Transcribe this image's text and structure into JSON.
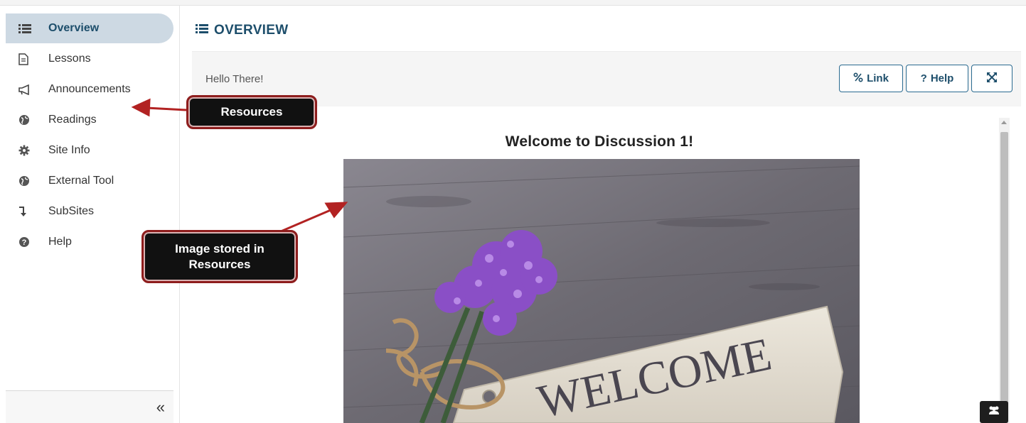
{
  "sidebar": {
    "items": [
      {
        "label": "Overview",
        "icon": "list-icon",
        "active": true
      },
      {
        "label": "Lessons",
        "icon": "document-icon",
        "active": false
      },
      {
        "label": "Announcements",
        "icon": "bullhorn-icon",
        "active": false
      },
      {
        "label": "Readings",
        "icon": "globe-icon",
        "active": false
      },
      {
        "label": "Site Info",
        "icon": "gear-icon",
        "active": false
      },
      {
        "label": "External Tool",
        "icon": "globe-icon",
        "active": false
      },
      {
        "label": "SubSites",
        "icon": "level-down-icon",
        "active": false
      },
      {
        "label": "Help",
        "icon": "question-circle-icon",
        "active": false
      }
    ],
    "collapse_label": "«"
  },
  "header": {
    "title": "OVERVIEW",
    "icon": "list-icon"
  },
  "toolbar": {
    "title": "Hello There!",
    "link_label": "Link",
    "help_label": "Help",
    "maximize_icon": "expand-icon"
  },
  "content": {
    "heading": "Welcome to Discussion 1!",
    "image_sign_text": "WELCOME"
  },
  "callouts": {
    "resources": "Resources",
    "image_line1": "Image stored in",
    "image_line2": "Resources"
  },
  "colors": {
    "accent": "#1d4e6b",
    "active_bg": "#cdd9e3",
    "callout_border": "#8e1d1d",
    "arrow": "#b22222"
  }
}
